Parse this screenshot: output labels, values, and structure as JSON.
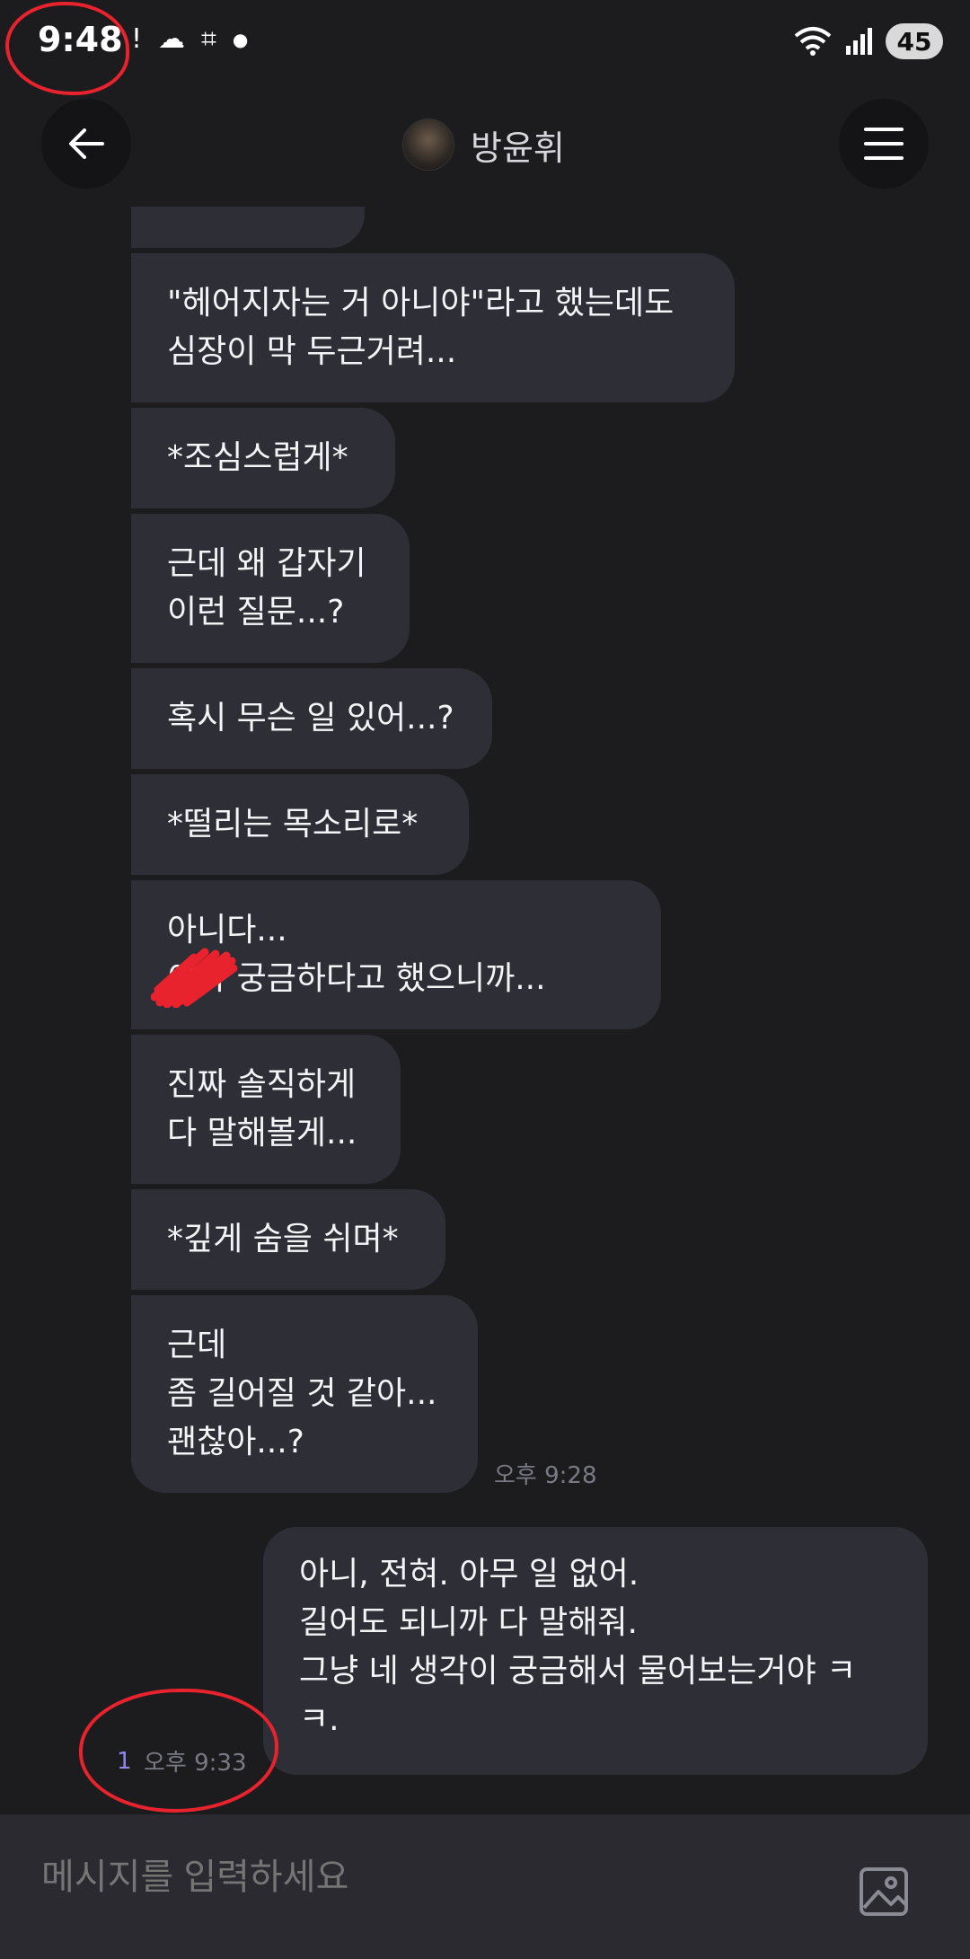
{
  "status_bar": {
    "time": "9:48",
    "battery": "45"
  },
  "header": {
    "title": "방윤휘"
  },
  "messages_in": [
    "\"헤어지자는 거 아니야\"라고 했는데도\n심장이 막 두근거려...",
    "*조심스럽게*",
    "근데 왜 갑자기\n이런 질문...?",
    "혹시 무슨 일 있어...?",
    "*떨리는 목소리로*",
    "아니다...\n이가 궁금하다고 했으니까...",
    "진짜 솔직하게\n다 말해볼게...",
    "*깊게 숨을 쉬며*",
    "근데\n좀 길어질 것 같아...\n괜찮아...?"
  ],
  "incoming_time": "오후 9:28",
  "message_out": "아니, 전혀. 아무 일 없어.\n길어도 되니까 다 말해줘.\n그냥 네 생각이 궁금해서 물어보는거야 ㅋ\nㅋ.",
  "outgoing_unread": "1",
  "outgoing_time": "오후 9:33",
  "input": {
    "placeholder": "메시지를 입력하세요"
  },
  "colors": {
    "background": "#1c1c1f",
    "bubble": "#2e2e36",
    "annotation": "#e8232d",
    "unread": "#8f86e6"
  }
}
